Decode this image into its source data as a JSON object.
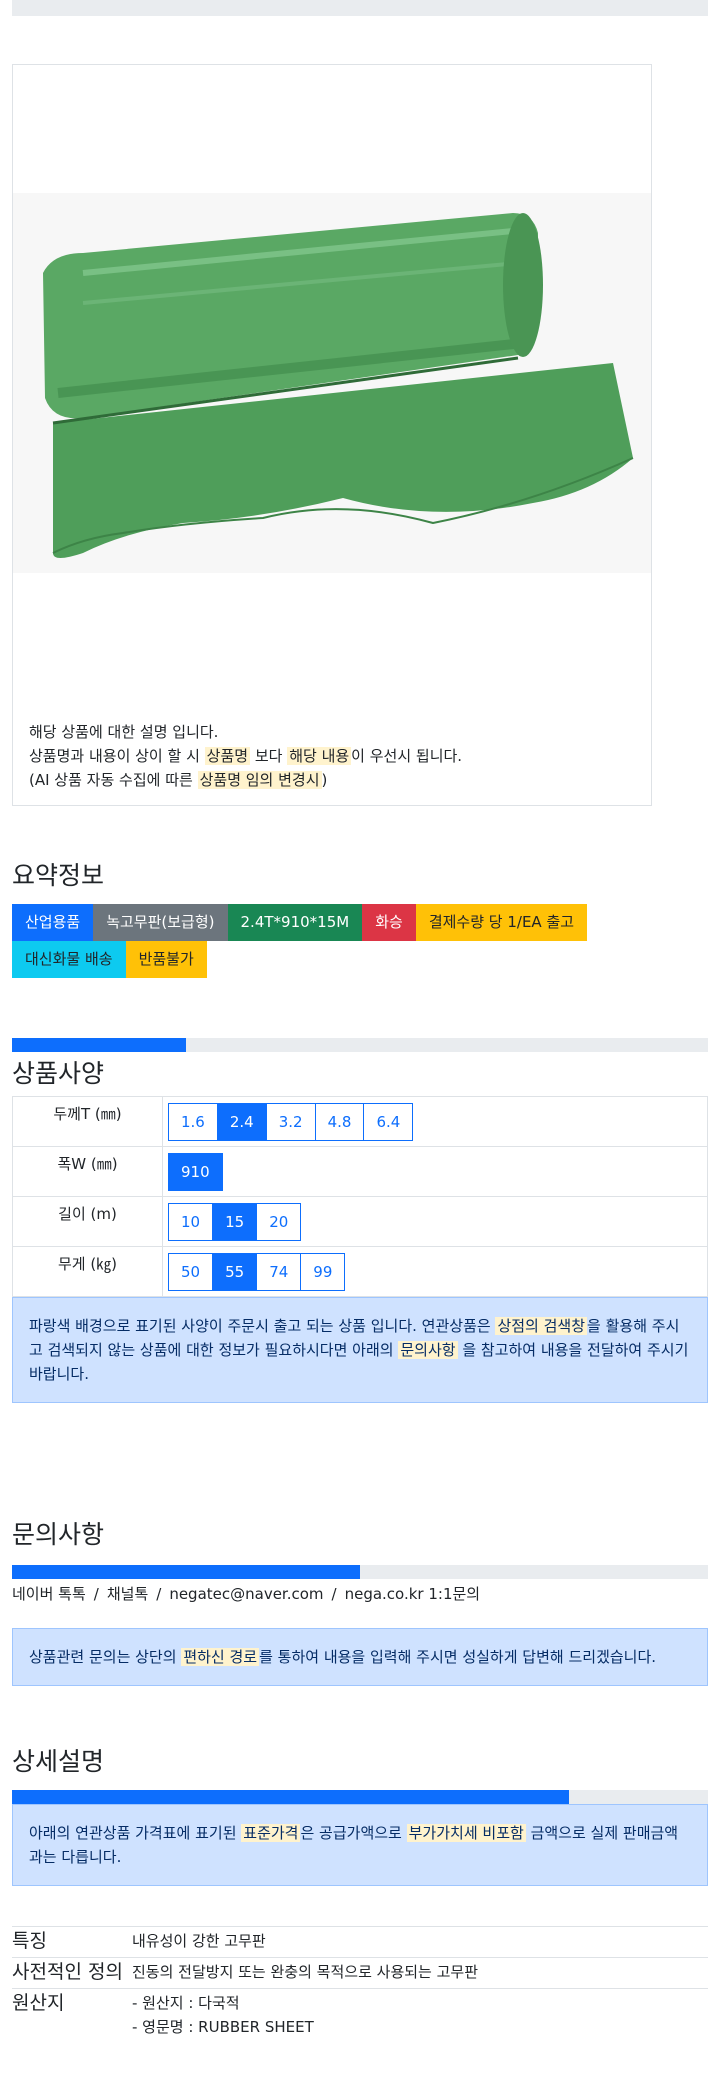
{
  "product": {
    "image_alt": "green rubber sheet roll",
    "description_lines": [
      [
        "해당 상품에 대한 설명 입니다."
      ],
      [
        "상품명과 내용이 상이 할 시 ",
        "상품명",
        " 보다 ",
        "해당 내용",
        "이 우선시 됩니다."
      ],
      [
        "(AI 상품 자동 수집에 따른 ",
        "상품명 임의 변경시",
        ")"
      ]
    ]
  },
  "summary": {
    "title": "요약정보",
    "badges": [
      {
        "label": "산업용품",
        "color": "primary"
      },
      {
        "label": "녹고무판(보급형)",
        "color": "gray"
      },
      {
        "label": "2.4T*910*15M",
        "color": "green"
      },
      {
        "label": "화승",
        "color": "red"
      },
      {
        "label": "결제수량 당 1/EA 출고",
        "color": "yellow"
      },
      {
        "label": "대신화물 배송",
        "color": "cyan"
      },
      {
        "label": "반품불가",
        "color": "yellow"
      }
    ]
  },
  "spec": {
    "title": "상품사양",
    "progress": 0.25,
    "rows": [
      {
        "label": "두께T (㎜)",
        "options": [
          "1.6",
          "2.4",
          "3.2",
          "4.8",
          "6.4"
        ],
        "selected": "2.4"
      },
      {
        "label": "폭W (㎜)",
        "options": [
          "910"
        ],
        "selected": "910"
      },
      {
        "label": "길이 (m)",
        "options": [
          "10",
          "15",
          "20"
        ],
        "selected": "15"
      },
      {
        "label": "무게 (㎏)",
        "options": [
          "50",
          "55",
          "74",
          "99"
        ],
        "selected": "55"
      }
    ],
    "notice": [
      "파랑색 배경으로 표기된 사양이 주문시 출고 되는 상품 입니다. 연관상품은 ",
      "상점의 검색창",
      "을 활용해 주시고 검색되지 않는 상품에 대한 정보가 필요하시다면 아래의 ",
      "문의사항",
      " 을 참고하여 내용을 전달하여 주시기 바랍니다."
    ]
  },
  "inquiry": {
    "title": "문의사항",
    "progress": 0.5,
    "contacts": [
      "네이버 톡톡",
      "채널톡",
      "negatec@naver.com",
      "nega.co.kr 1:1문의"
    ],
    "notice": [
      "상품관련 문의는 상단의 ",
      "편하신 경로",
      "를 통하여 내용을 입력해 주시면 성실하게 답변해 드리겠습니다."
    ]
  },
  "detail": {
    "title": "상세설명",
    "progress": 0.8,
    "notice": [
      "아래의 연관상품 가격표에 표기된 ",
      "표준가격",
      "은 공급가액으로 ",
      "부가가치세 비포함",
      " 금액으로 실제 판매금액과는 다릅니다."
    ],
    "features": [
      {
        "key": "특징",
        "values": [
          "내유성이 강한 고무판"
        ]
      },
      {
        "key": "사전적인 정의",
        "values": [
          "진동의 전달방지 또는 완충의 목적으로 사용되는 고무판"
        ]
      },
      {
        "key": "원산지",
        "values": [
          "- 원산지 : 다국적",
          "- 영문명 : RUBBER SHEET"
        ]
      }
    ]
  }
}
